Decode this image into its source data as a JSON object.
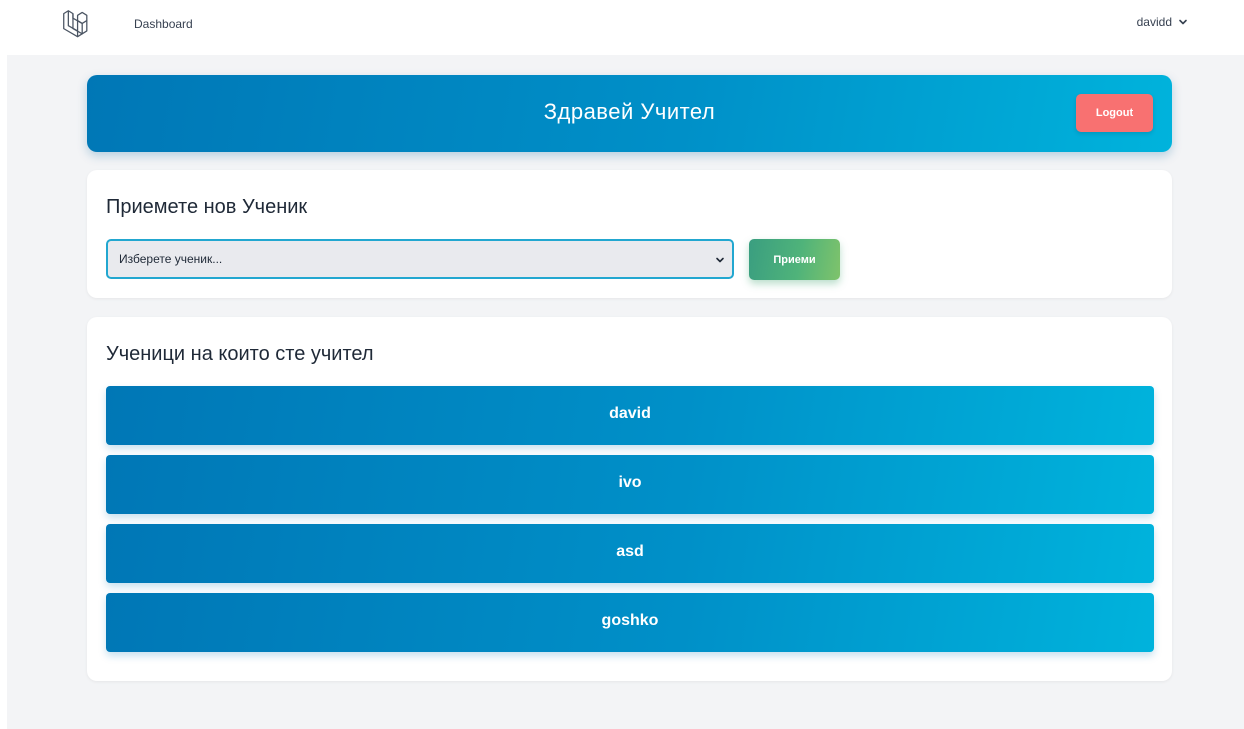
{
  "nav": {
    "dashboard_label": "Dashboard",
    "user_name": "davidd",
    "logo_icon": "laravel-logo-icon",
    "user_menu_icon": "chevron-down-icon"
  },
  "banner": {
    "title": "Здравей Учител",
    "logout_label": "Logout"
  },
  "admit": {
    "title": "Приемете нов Ученик",
    "select_value": "Изберете ученик...",
    "select_icon": "chevron-down-icon",
    "admit_label": "Приеми"
  },
  "students": {
    "title": "Ученици на които сте учител",
    "items": [
      {
        "name": "david"
      },
      {
        "name": "ivo"
      },
      {
        "name": "asd"
      },
      {
        "name": "goshko"
      }
    ]
  },
  "colors": {
    "primary_gradient_start": "#0077b6",
    "primary_gradient_end": "#00b3dc",
    "logout": "#f87171",
    "admit_gradient_start": "#3a9e80",
    "admit_gradient_end": "#7fc36b",
    "page_background": "#f3f4f6",
    "select_border": "#22a7d0"
  }
}
